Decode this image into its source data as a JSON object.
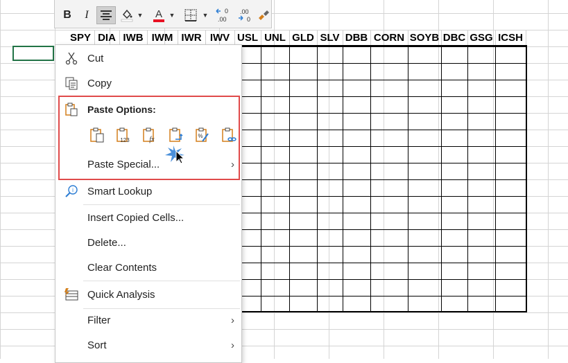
{
  "headers": [
    "SPY",
    "DIA",
    "IWB",
    "IWM",
    "IWR",
    "IWV",
    "USL",
    "UNL",
    "GLD",
    "SLV",
    "DBB",
    "CORN",
    "SOYB",
    "DBC",
    "GSG",
    "ICSH"
  ],
  "toolbar": {
    "bold": "B",
    "italic": "I"
  },
  "menu": {
    "cut": "Cut",
    "copy": "Copy",
    "paste_options": "Paste Options:",
    "paste_special": "Paste Special...",
    "smart_lookup": "Smart Lookup",
    "insert_copied_cells": "Insert Copied Cells...",
    "delete": "Delete...",
    "clear_contents": "Clear Contents",
    "quick_analysis": "Quick Analysis",
    "filter": "Filter",
    "sort": "Sort"
  },
  "paste_icons": [
    "paste-icon",
    "paste-values-icon",
    "paste-formulas-icon",
    "paste-transpose-icon",
    "paste-formatting-icon",
    "paste-link-icon"
  ],
  "colors": {
    "accent_red": "#e04a4a",
    "excel_green": "#217346",
    "font_red": "#e81123",
    "icon_orange": "#d47f1b",
    "icon_blue": "#2b7cd3"
  }
}
